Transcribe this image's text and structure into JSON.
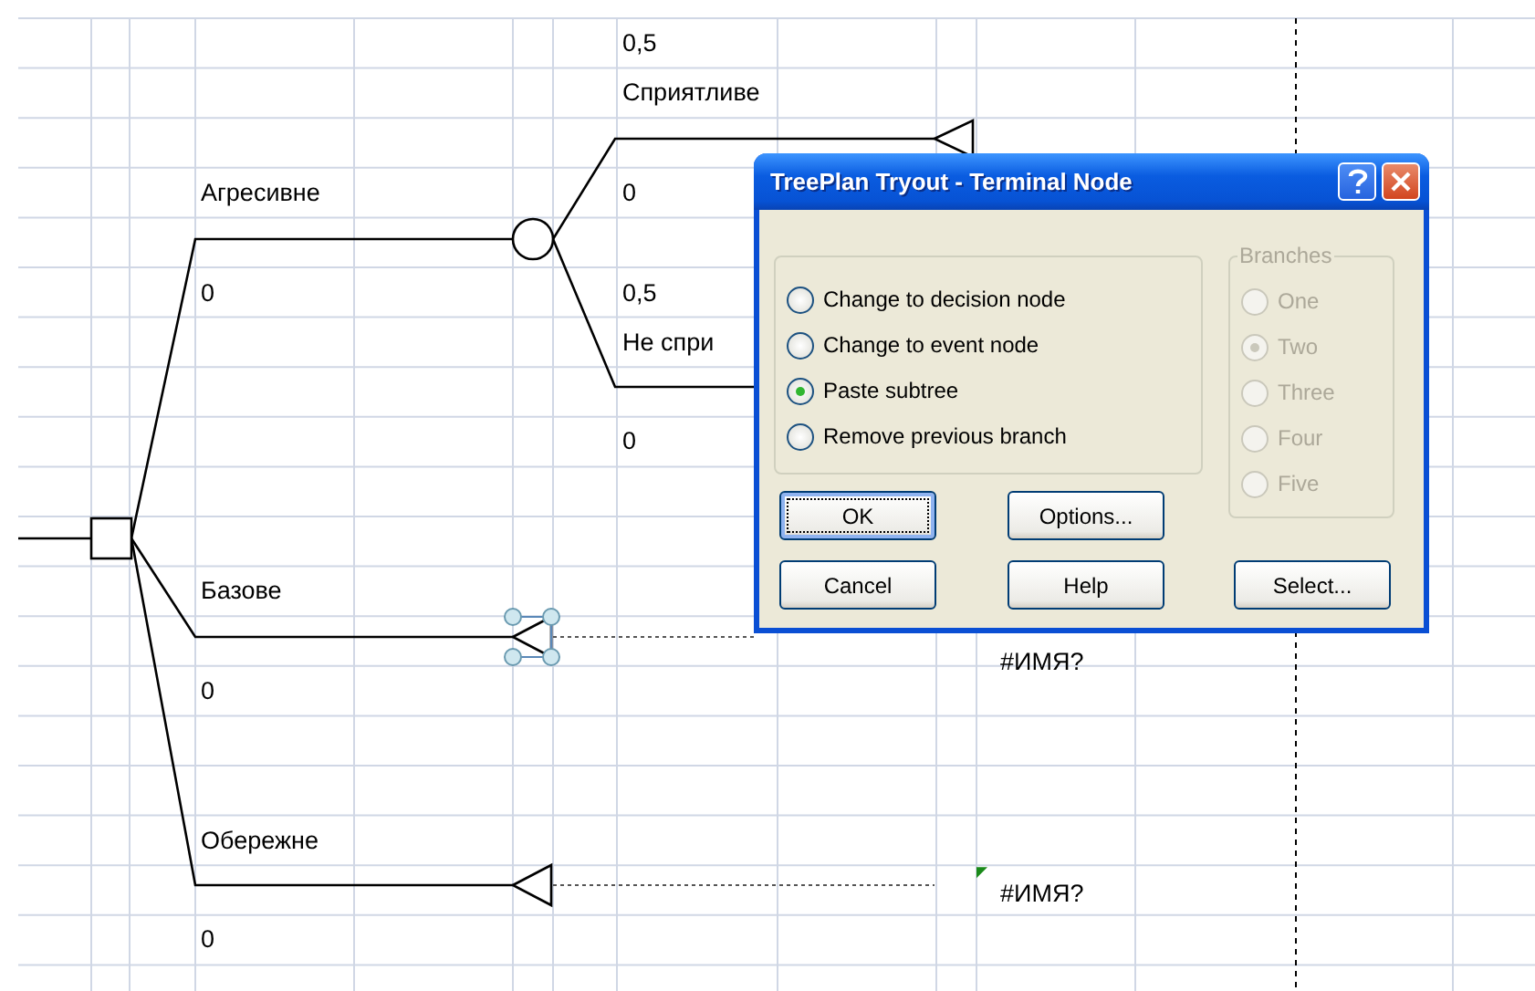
{
  "tree": {
    "branches": [
      {
        "label": "Агресивне",
        "value": "0",
        "kind": "event",
        "selected": false,
        "outcomes": [
          {
            "probability": "0,5",
            "label": "Сприятливе",
            "value": "0"
          },
          {
            "probability": "0,5",
            "label": "Не спри",
            "value": "0"
          }
        ]
      },
      {
        "label": "Базове",
        "value": "0",
        "kind": "terminal",
        "selected": true,
        "result": "#ИМЯ?"
      },
      {
        "label": "Обережне",
        "value": "0",
        "kind": "terminal",
        "selected": false,
        "result": "#ИМЯ?",
        "error_mark": true
      }
    ]
  },
  "dialog": {
    "title": "TreePlan Tryout - Terminal Node",
    "actions": [
      {
        "label": "Change to decision node",
        "selected": false
      },
      {
        "label": "Change to event node",
        "selected": false
      },
      {
        "label": "Paste subtree",
        "selected": true
      },
      {
        "label": "Remove previous branch",
        "selected": false
      }
    ],
    "branches_group": {
      "title": "Branches",
      "disabled": true,
      "options": [
        {
          "label": "One",
          "selected": false
        },
        {
          "label": "Two",
          "selected": true
        },
        {
          "label": "Three",
          "selected": false
        },
        {
          "label": "Four",
          "selected": false
        },
        {
          "label": "Five",
          "selected": false
        }
      ]
    },
    "buttons": [
      {
        "label": "OK",
        "default": true
      },
      {
        "label": "Options...",
        "default": false
      },
      {
        "label": "Cancel",
        "default": false
      },
      {
        "label": "Help",
        "default": false
      },
      {
        "label": "Select...",
        "default": false
      }
    ]
  }
}
